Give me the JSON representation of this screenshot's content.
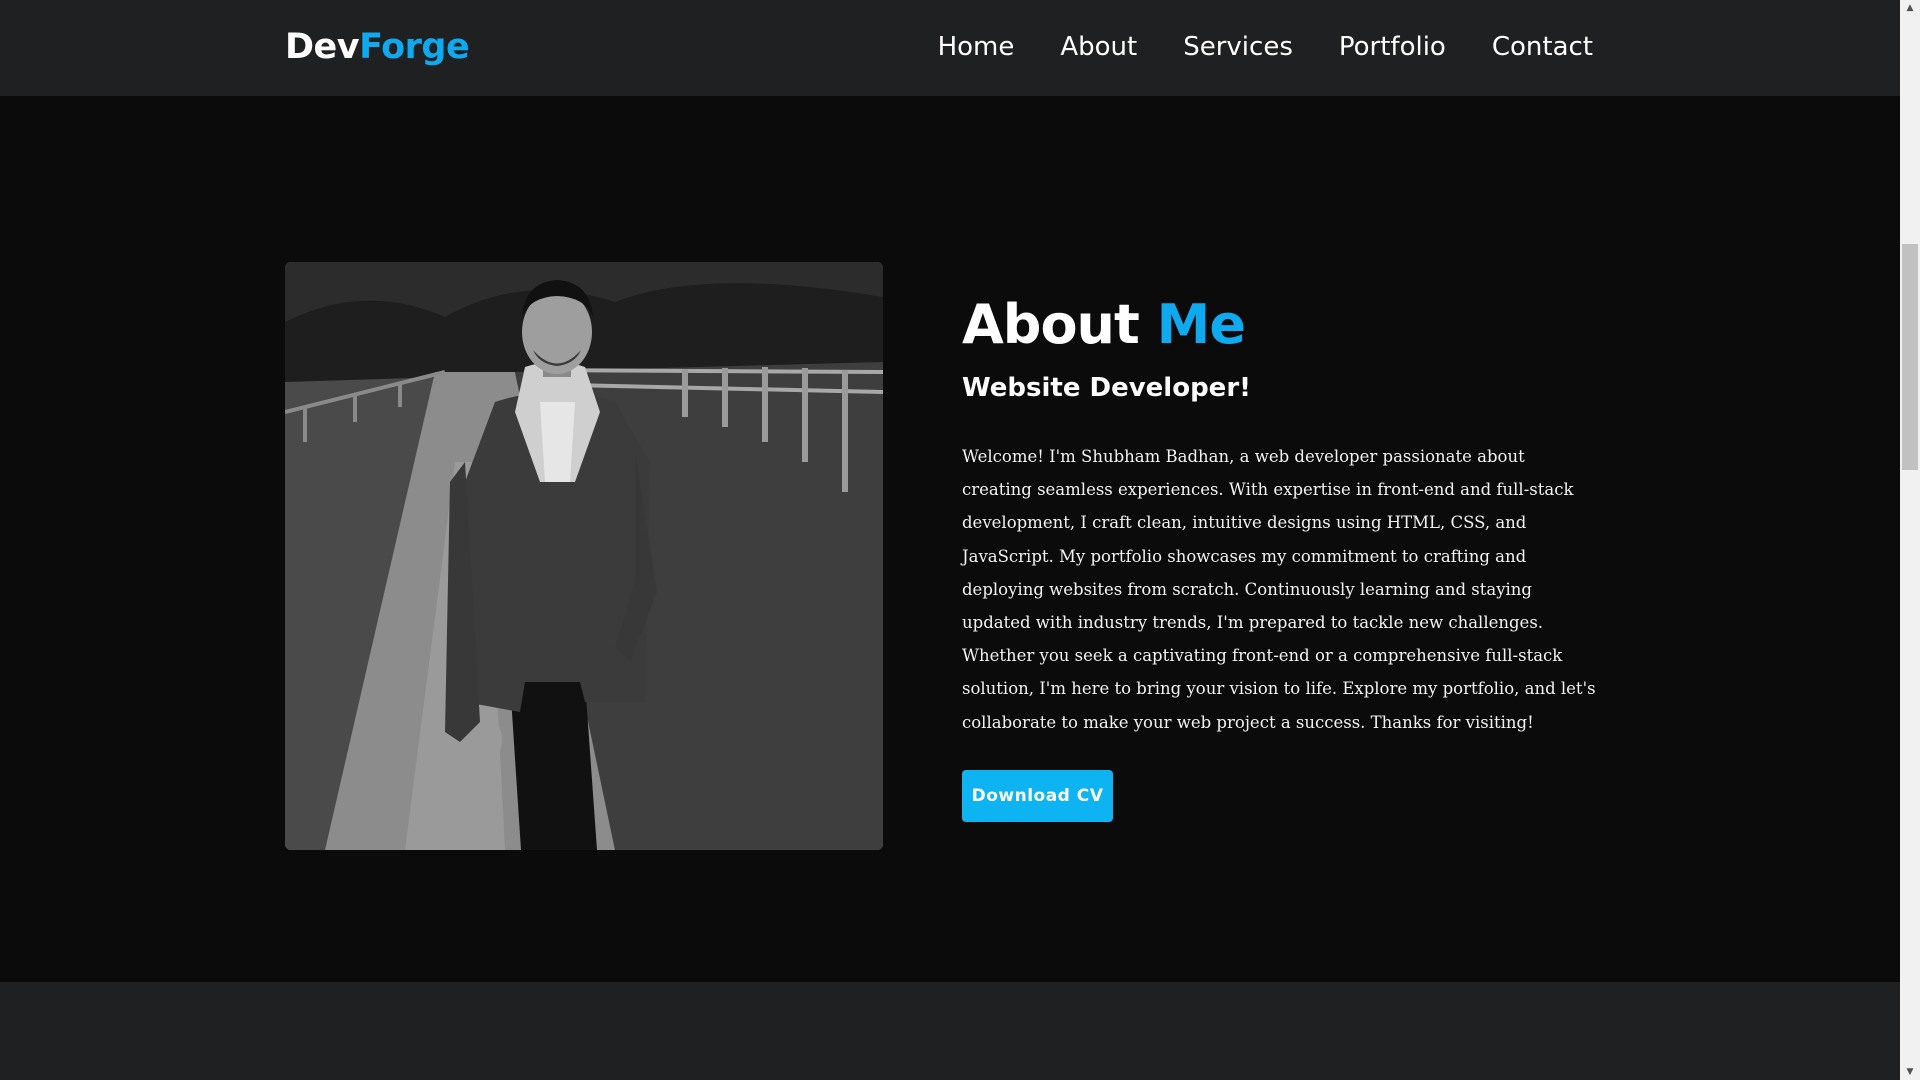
{
  "header": {
    "logo_part1": "Dev",
    "logo_part2": "Forge",
    "nav": [
      {
        "label": "Home"
      },
      {
        "label": "About"
      },
      {
        "label": "Services"
      },
      {
        "label": "Portfolio"
      },
      {
        "label": "Contact"
      }
    ]
  },
  "about": {
    "title_part1": "About ",
    "title_part2": "Me",
    "subtitle": "Website Developer!",
    "description": "Welcome! I'm Shubham Badhan, a web developer passionate about creating seamless experiences. With expertise in front-end and full-stack development, I craft clean, intuitive designs using HTML, CSS, and JavaScript. My portfolio showcases my commitment to crafting and deploying websites from scratch. Continuously learning and staying updated with industry trends, I'm prepared to tackle new challenges. Whether you seek a captivating front-end or a comprehensive full-stack solution, I'm here to bring your vision to life. Explore my portfolio, and let's collaborate to make your web project a success. Thanks for visiting!",
    "cv_button": "Download CV",
    "photo_icon": "profile-photo"
  },
  "colors": {
    "accent": "#0ea9ef",
    "button": "#0eb4f2",
    "header_bg": "#1f2021",
    "page_bg": "#0b0b0c"
  },
  "scrollbar": {
    "up_icon": "scroll-up-arrow-icon",
    "down_icon": "scroll-down-arrow-icon"
  }
}
